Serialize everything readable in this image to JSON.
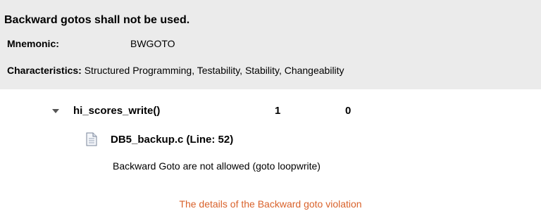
{
  "rule": {
    "title": "Backward gotos shall not be used.",
    "mnemonic_label": "Mnemonic:",
    "mnemonic_value": "BWGOTO",
    "characteristics_label": "Characteristics:",
    "characteristics_value": "Structured Programming, Testability, Stability, Changeability"
  },
  "tree": {
    "function_name": "hi_scores_write()",
    "count_a": "1",
    "count_b": "0",
    "expand_icon": "chevron-down-icon",
    "file": {
      "icon": "file-icon",
      "label": "DB5_backup.c (Line: 52)"
    },
    "message": "Backward Goto are not allowed (goto loopwrite)"
  },
  "caption": "The details of the Backward goto violation",
  "colors": {
    "panel_bg": "#ebebeb",
    "caption": "#d9622b"
  }
}
